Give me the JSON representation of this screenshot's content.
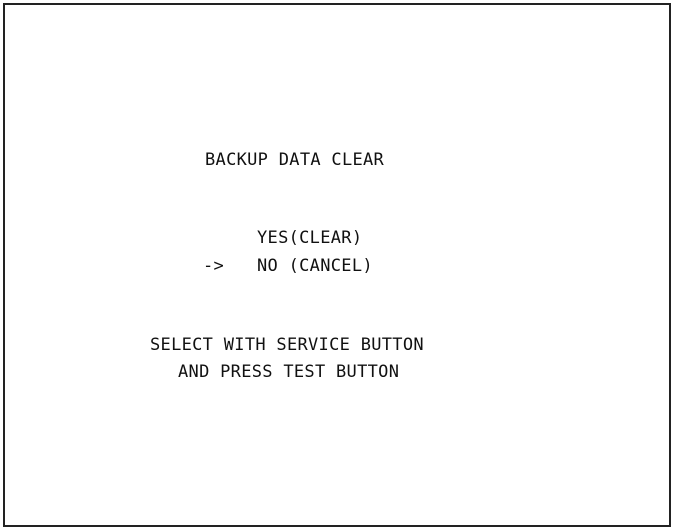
{
  "menu": {
    "title": "BACKUP DATA CLEAR",
    "options": [
      {
        "label": "YES(CLEAR)",
        "selected": false
      },
      {
        "label": "NO (CANCEL)",
        "selected": true
      }
    ],
    "cursor": "->"
  },
  "instructions": {
    "line1": "SELECT WITH SERVICE BUTTON",
    "line2": "AND PRESS TEST BUTTON"
  }
}
